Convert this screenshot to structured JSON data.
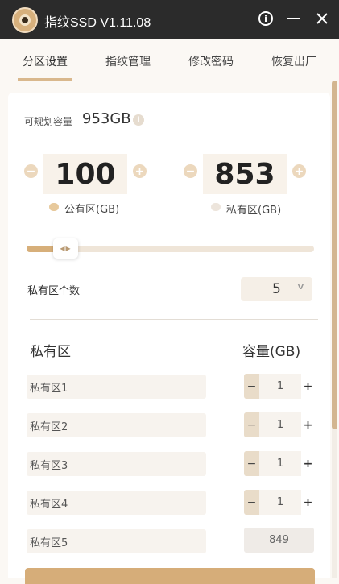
{
  "window": {
    "title": "指纹SSD V1.11.08"
  },
  "tabs": [
    {
      "label": "分区设置",
      "active": true
    },
    {
      "label": "指纹管理",
      "active": false
    },
    {
      "label": "修改密码",
      "active": false
    },
    {
      "label": "恢复出厂",
      "active": false
    }
  ],
  "capacity": {
    "label": "可规划容量",
    "value": "953GB"
  },
  "partitions": {
    "public": {
      "value": "100",
      "label": "公有区(GB)",
      "color": "#e7c99c"
    },
    "private": {
      "value": "853",
      "label": "私有区(GB)",
      "color": "#ede5dc"
    },
    "slider_fraction": 0.105
  },
  "count": {
    "label": "私有区个数",
    "value": "5"
  },
  "table": {
    "header_name": "私有区",
    "header_capacity": "容量(GB)",
    "rows": [
      {
        "name": "私有区1",
        "capacity": "1"
      },
      {
        "name": "私有区2",
        "capacity": "1"
      },
      {
        "name": "私有区3",
        "capacity": "1"
      },
      {
        "name": "私有区4",
        "capacity": "1"
      },
      {
        "name": "私有区5",
        "capacity": "849"
      }
    ],
    "minus_symbol": "−",
    "plus_symbol": "+"
  },
  "colors": {
    "accent": "#d6ad79",
    "titlebar": "#2b2b2b"
  }
}
